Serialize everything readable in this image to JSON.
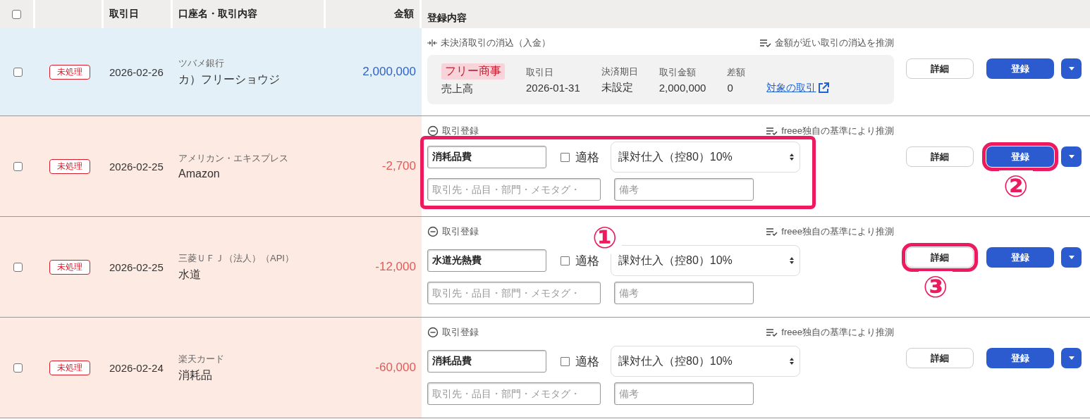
{
  "header": {
    "select_all_checked": false,
    "date": "取引日",
    "account": "口座名・取引内容",
    "amount": "金額",
    "content": "登録内容"
  },
  "rows": [
    {
      "kind": "deposit",
      "checked": false,
      "status": "未処理",
      "date": "2026-02-26",
      "account": "ツバメ銀行",
      "description": "カ）フリーショウジ",
      "amount": "2,000,000",
      "mode": {
        "kind": "reconcile",
        "label": "未決済取引の消込（入金）",
        "guess": "金額が近い取引の消込を推測",
        "partner": "フリー商事",
        "account_item": "売上高",
        "fields": [
          {
            "label": "取引日",
            "value": "2026-01-31"
          },
          {
            "label": "決済期日",
            "value": "未設定"
          },
          {
            "label": "取引金額",
            "value": "2,000,000"
          },
          {
            "label": "差額",
            "value": "0"
          }
        ],
        "link": "対象の取引"
      },
      "detail_button": {
        "label": "詳細",
        "highlighted": false
      },
      "register_button": {
        "label": "登録",
        "highlighted": false
      }
    },
    {
      "kind": "withdrawal",
      "checked": false,
      "status": "未処理",
      "date": "2026-02-25",
      "account": "アメリカン・エキスプレス",
      "description": "Amazon",
      "amount": "-2,700",
      "mode": {
        "kind": "entry",
        "label": "取引登録",
        "guess": "freee独自の基準により推測",
        "account_item": "消耗品費",
        "qualified": {
          "label": "適格",
          "checked": false
        },
        "tax": "課対仕入（控80）10%",
        "partner_placeholder": "取引先・品目・部門・メモタグ・",
        "memo_placeholder": "備考",
        "highlighted": true,
        "callout": "①"
      },
      "detail_button": {
        "label": "詳細",
        "highlighted": false
      },
      "register_button": {
        "label": "登録",
        "highlighted": true,
        "callout": "②"
      }
    },
    {
      "kind": "withdrawal",
      "checked": false,
      "status": "未処理",
      "date": "2026-02-25",
      "account": "三菱ＵＦＪ（法人）（API）",
      "description": "水道",
      "amount": "-12,000",
      "mode": {
        "kind": "entry",
        "label": "取引登録",
        "guess": "freee独自の基準により推測",
        "account_item": "水道光熱費",
        "qualified": {
          "label": "適格",
          "checked": false
        },
        "tax": "課対仕入（控80）10%",
        "partner_placeholder": "取引先・品目・部門・メモタグ・",
        "memo_placeholder": "備考",
        "highlighted": false
      },
      "detail_button": {
        "label": "詳細",
        "highlighted": true,
        "callout": "③"
      },
      "register_button": {
        "label": "登録",
        "highlighted": false
      }
    },
    {
      "kind": "withdrawal",
      "checked": false,
      "status": "未処理",
      "date": "2026-02-24",
      "account": "楽天カード",
      "description": "消耗品",
      "amount": "-60,000",
      "mode": {
        "kind": "entry",
        "label": "取引登録",
        "guess": "freee独自の基準により推測",
        "account_item": "消耗品費",
        "qualified": {
          "label": "適格",
          "checked": false
        },
        "tax": "課対仕入（控80）10%",
        "partner_placeholder": "取引先・品目・部門・メモタグ・",
        "memo_placeholder": "備考",
        "highlighted": false
      },
      "detail_button": {
        "label": "詳細",
        "highlighted": false
      },
      "register_button": {
        "label": "登録",
        "highlighted": false
      }
    }
  ]
}
